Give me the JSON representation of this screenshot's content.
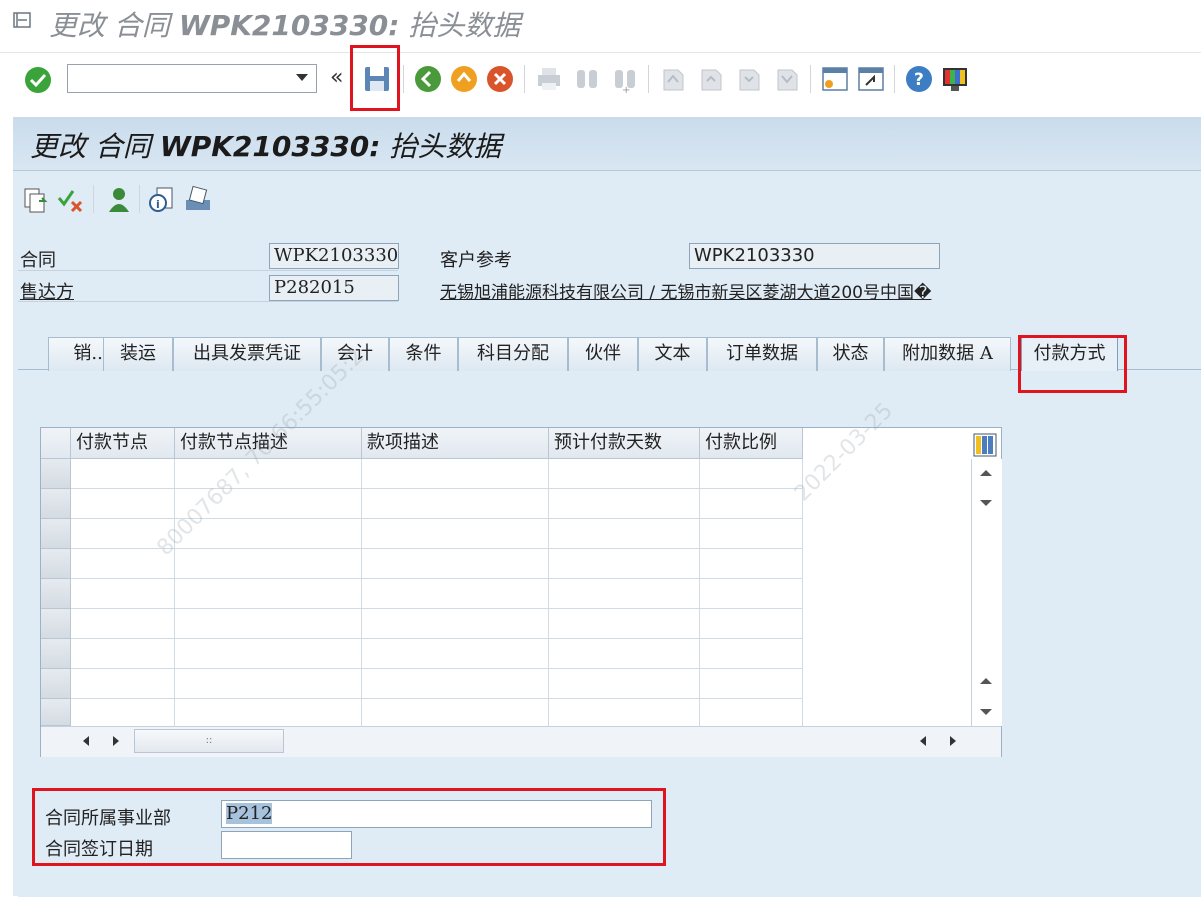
{
  "window": {
    "title_prefix": "更改 合同 ",
    "title_doc": "WPK2103330:",
    "title_suffix": " 抬头数据"
  },
  "screen": {
    "title_prefix": "更改 合同 ",
    "title_doc": "WPK2103330:",
    "title_suffix": " 抬头数据"
  },
  "header": {
    "contract_label": "合同",
    "contract_value": "WPK2103330",
    "customer_ref_label": "客户参考",
    "customer_ref_value": "WPK2103330",
    "sold_to_label": "售达方",
    "sold_to_value": "P282015",
    "sold_to_desc": "无锡旭浦能源科技有限公司 / 无锡市新吴区菱湖大道200号中国�"
  },
  "tabs": [
    {
      "label": "销..."
    },
    {
      "label": "装运"
    },
    {
      "label": "出具发票凭证"
    },
    {
      "label": "会计"
    },
    {
      "label": "条件"
    },
    {
      "label": "科目分配"
    },
    {
      "label": "伙伴"
    },
    {
      "label": "文本"
    },
    {
      "label": "订单数据"
    },
    {
      "label": "状态"
    },
    {
      "label": "附加数据 A"
    },
    {
      "label": "付款方式"
    }
  ],
  "table": {
    "columns": [
      "付款节点",
      "付款节点描述",
      "款项描述",
      "预计付款天数",
      "付款比例"
    ],
    "rows": 9,
    "hscroll_grip": "::"
  },
  "form": {
    "business_unit_label": "合同所属事业部",
    "business_unit_value": "P212",
    "sign_date_label": "合同签订日期",
    "sign_date_value": ""
  },
  "watermark": {
    "text1": "80007687, 70:66:55:05:2",
    "text2": "2022-03-25"
  },
  "colors": {
    "accent_red": "#e0141e",
    "screen_bg": "#dfebf5"
  }
}
